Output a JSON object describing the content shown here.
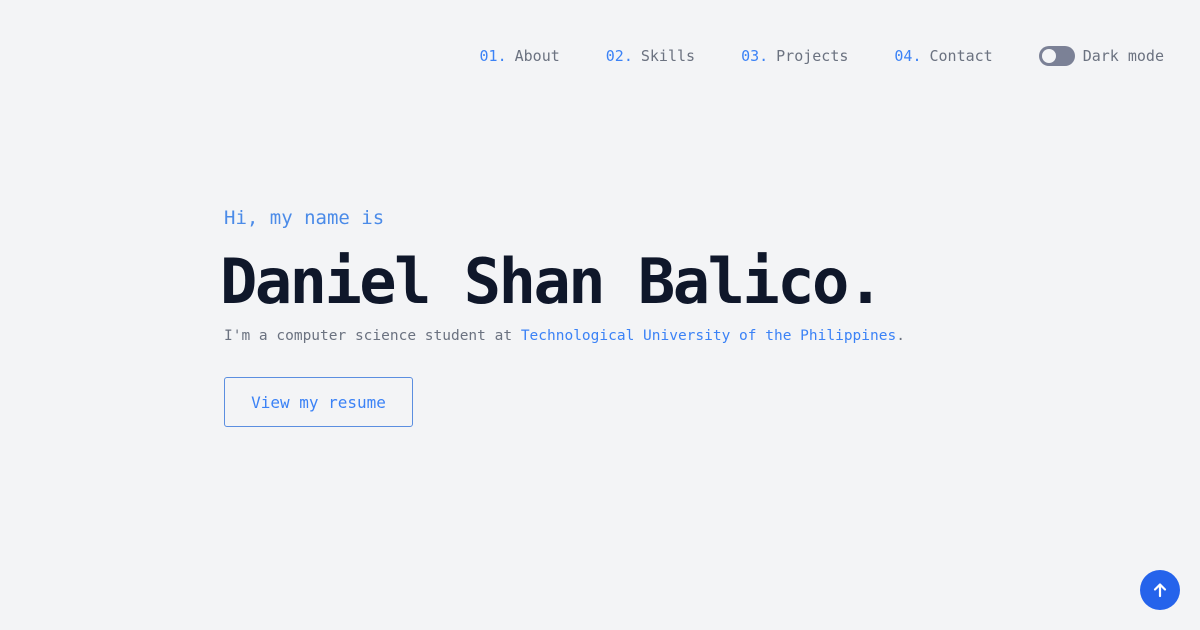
{
  "nav": {
    "items": [
      {
        "num": "01.",
        "label": "About"
      },
      {
        "num": "02.",
        "label": "Skills"
      },
      {
        "num": "03.",
        "label": "Projects"
      },
      {
        "num": "04.",
        "label": "Contact"
      }
    ],
    "dark_mode_label": "Dark mode",
    "dark_mode_on": false
  },
  "hero": {
    "greeting": "Hi, my name is",
    "name": "Daniel Shan Balico.",
    "tagline_prefix": "I'm a computer science student at ",
    "tagline_link": "Technological University of the Philippines",
    "tagline_suffix": ".",
    "resume_button": "View my resume"
  },
  "scroll_top": {
    "icon": "arrow-up-icon"
  },
  "colors": {
    "background": "#f3f4f6",
    "accent": "#3b82f6",
    "heading": "#0f172a",
    "muted": "#6b7280",
    "fab": "#2563eb"
  }
}
